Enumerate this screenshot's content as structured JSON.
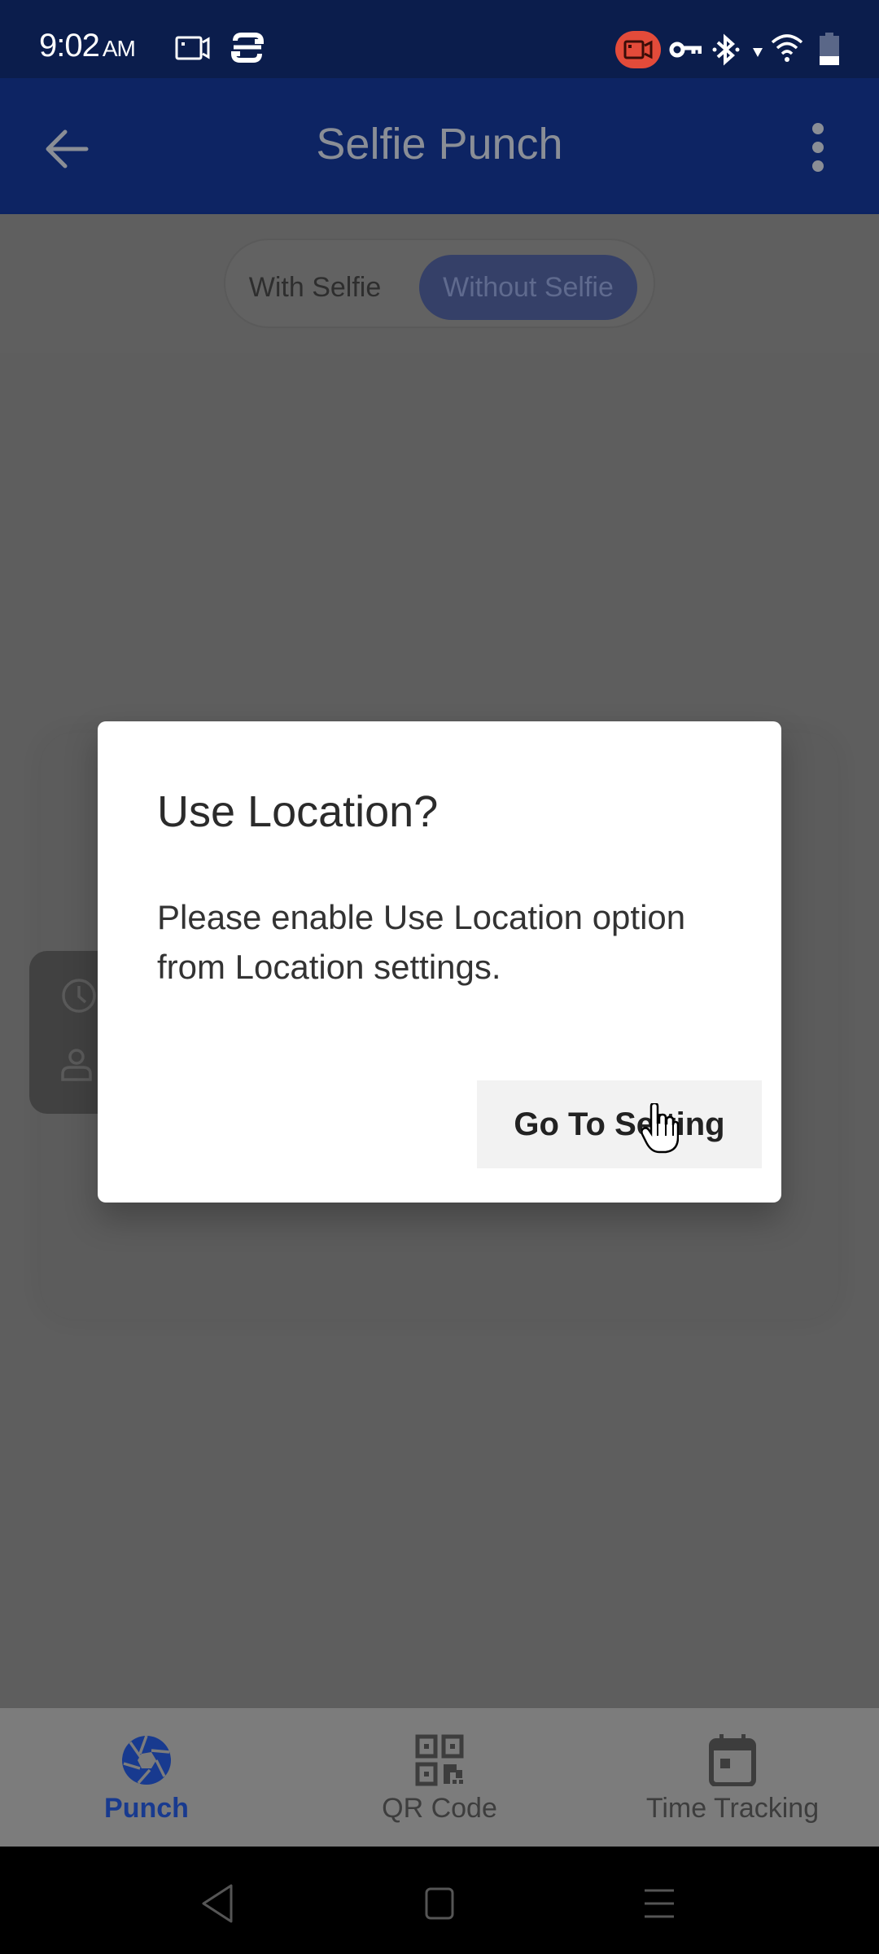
{
  "status_bar": {
    "time": "9:02",
    "ampm": "AM",
    "icons": [
      "screen-record-icon",
      "sync-icon",
      "recording-badge-icon",
      "vpn-key-icon",
      "bluetooth-icon",
      "data-arrow-icon",
      "wifi-icon",
      "battery-icon"
    ]
  },
  "app_bar": {
    "title": "Selfie Punch",
    "back_icon": "arrow-left-icon",
    "more_icon": "more-vertical-icon"
  },
  "toggle": {
    "options": [
      "With Selfie",
      "Without Selfie"
    ],
    "selected": "Without Selfie"
  },
  "dialog": {
    "title": "Use Location?",
    "message": "Please enable Use Location option from Location settings.",
    "button_label": "Go To Setting"
  },
  "bottom_nav": {
    "items": [
      {
        "label": "Punch",
        "icon": "camera-aperture-icon",
        "active": true
      },
      {
        "label": "QR Code",
        "icon": "qr-code-icon",
        "active": false
      },
      {
        "label": "Time Tracking",
        "icon": "calendar-icon",
        "active": false
      }
    ]
  },
  "colors": {
    "status_bar": "#0b1d4c",
    "app_bar": "#0d2463",
    "accent": "#183a8f",
    "recording_badge": "#e34b3a",
    "scrim_bg": "#5e5e5e"
  }
}
